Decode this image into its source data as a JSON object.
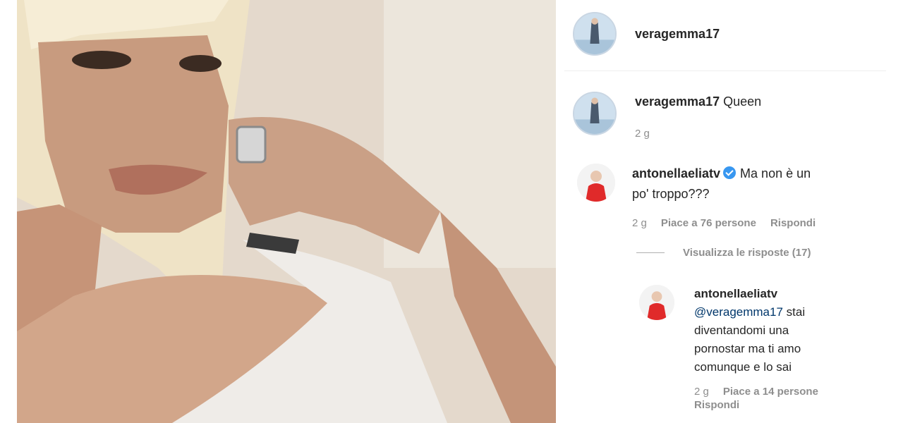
{
  "post": {
    "author": "veragemma17"
  },
  "caption": {
    "username": "veragemma17",
    "text": "Queen",
    "time": "2 g"
  },
  "comments": [
    {
      "username": "antonellaeliatv",
      "verified": true,
      "text_line1": "Ma non è un",
      "text_line2": "po' troppo???",
      "time": "2 g",
      "likes": "Piace a 76 persone",
      "reply_label": "Rispondi",
      "view_replies": "Visualizza le risposte (17)"
    }
  ],
  "reply": {
    "username": "antonellaeliatv",
    "mention": "@veragemma17",
    "line1_rest": " stai",
    "line2": "diventandomi una",
    "line3": "pornostar ma ti amo",
    "line4": "comunque e lo sai",
    "time": "2 g",
    "likes": "Piace a 14 persone",
    "reply_label": "Rispondi"
  },
  "colors": {
    "link_blue": "#00376b",
    "meta_gray": "#8e8e8e",
    "verified_blue": "#3897f0"
  }
}
